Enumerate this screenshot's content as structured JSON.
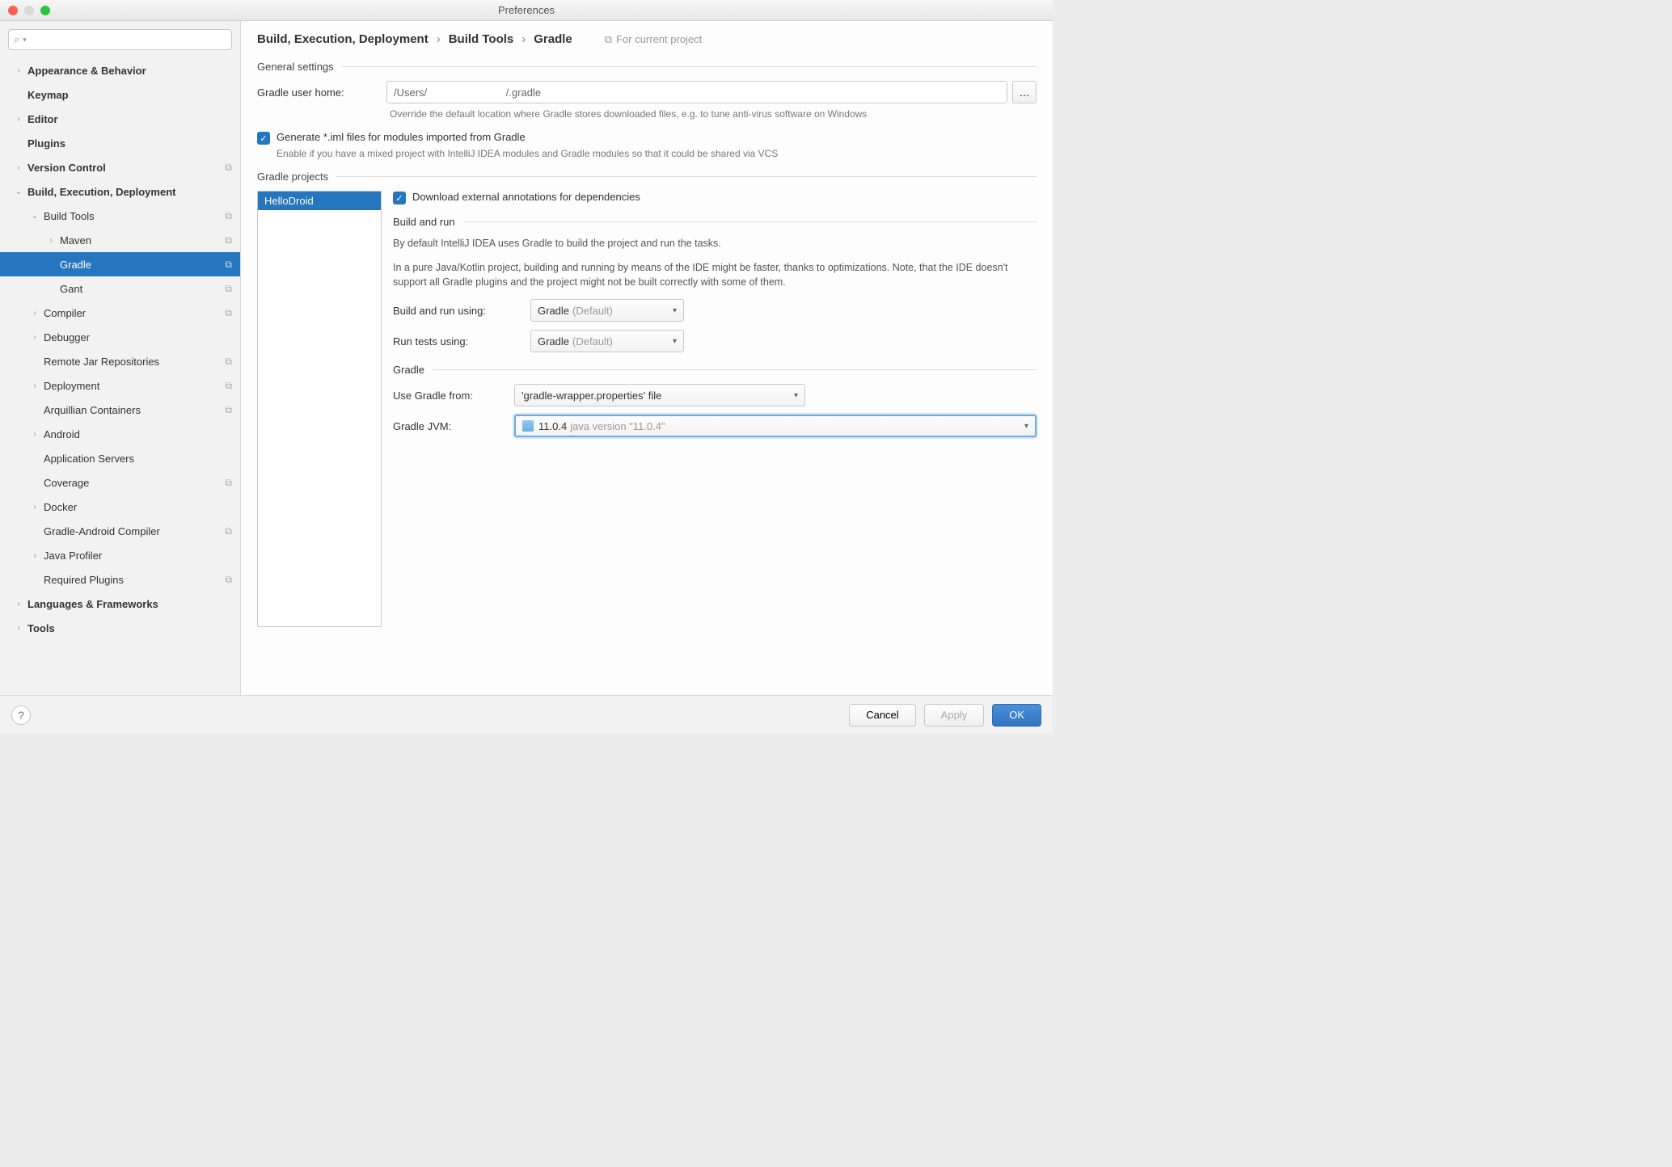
{
  "window": {
    "title": "Preferences"
  },
  "search": {
    "placeholder": ""
  },
  "breadcrumb": {
    "a": "Build, Execution, Deployment",
    "b": "Build Tools",
    "c": "Gradle",
    "hint": "For current project"
  },
  "tree": [
    {
      "label": "Appearance & Behavior",
      "indent": 0,
      "arrow": "›",
      "bold": true
    },
    {
      "label": "Keymap",
      "indent": 0,
      "arrow": "",
      "bold": true
    },
    {
      "label": "Editor",
      "indent": 0,
      "arrow": "›",
      "bold": true
    },
    {
      "label": "Plugins",
      "indent": 0,
      "arrow": "",
      "bold": true
    },
    {
      "label": "Version Control",
      "indent": 0,
      "arrow": "›",
      "bold": true,
      "copy": true
    },
    {
      "label": "Build, Execution, Deployment",
      "indent": 0,
      "arrow": "⌄",
      "bold": true
    },
    {
      "label": "Build Tools",
      "indent": 1,
      "arrow": "⌄",
      "bold": false,
      "copy": true
    },
    {
      "label": "Maven",
      "indent": 2,
      "arrow": "›",
      "bold": false,
      "copy": true
    },
    {
      "label": "Gradle",
      "indent": 2,
      "arrow": "",
      "bold": false,
      "copy": true,
      "selected": true
    },
    {
      "label": "Gant",
      "indent": 2,
      "arrow": "",
      "bold": false,
      "copy": true
    },
    {
      "label": "Compiler",
      "indent": 1,
      "arrow": "›",
      "bold": false,
      "copy": true
    },
    {
      "label": "Debugger",
      "indent": 1,
      "arrow": "›",
      "bold": false
    },
    {
      "label": "Remote Jar Repositories",
      "indent": 1,
      "arrow": "",
      "bold": false,
      "copy": true
    },
    {
      "label": "Deployment",
      "indent": 1,
      "arrow": "›",
      "bold": false,
      "copy": true
    },
    {
      "label": "Arquillian Containers",
      "indent": 1,
      "arrow": "",
      "bold": false,
      "copy": true
    },
    {
      "label": "Android",
      "indent": 1,
      "arrow": "›",
      "bold": false
    },
    {
      "label": "Application Servers",
      "indent": 1,
      "arrow": "",
      "bold": false
    },
    {
      "label": "Coverage",
      "indent": 1,
      "arrow": "",
      "bold": false,
      "copy": true
    },
    {
      "label": "Docker",
      "indent": 1,
      "arrow": "›",
      "bold": false
    },
    {
      "label": "Gradle-Android Compiler",
      "indent": 1,
      "arrow": "",
      "bold": false,
      "copy": true
    },
    {
      "label": "Java Profiler",
      "indent": 1,
      "arrow": "›",
      "bold": false
    },
    {
      "label": "Required Plugins",
      "indent": 1,
      "arrow": "",
      "bold": false,
      "copy": true
    },
    {
      "label": "Languages & Frameworks",
      "indent": 0,
      "arrow": "›",
      "bold": true
    },
    {
      "label": "Tools",
      "indent": 0,
      "arrow": "›",
      "bold": true
    }
  ],
  "general": {
    "title": "General settings",
    "homeLabel": "Gradle user home:",
    "homeValue": "/Users/                           /.gradle",
    "homeHint": "Override the default location where Gradle stores downloaded files, e.g. to tune anti-virus software on Windows",
    "genImlLabel": "Generate *.iml files for modules imported from Gradle",
    "genImlHint": "Enable if you have a mixed project with IntelliJ IDEA modules and Gradle modules so that it could be shared via VCS"
  },
  "projects": {
    "title": "Gradle projects",
    "items": [
      "HelloDroid"
    ],
    "downloadAnnotations": "Download external annotations for dependencies",
    "buildRunTitle": "Build and run",
    "buildRunNote1": "By default IntelliJ IDEA uses Gradle to build the project and run the tasks.",
    "buildRunNote2": "In a pure Java/Kotlin project, building and running by means of the IDE might be faster, thanks to optimizations. Note, that the IDE doesn't support all Gradle plugins and the project might not be built correctly with some of them.",
    "buildUsingLabel": "Build and run using:",
    "buildUsingValue": "Gradle",
    "buildUsingDefault": "(Default)",
    "testsUsingLabel": "Run tests using:",
    "testsUsingValue": "Gradle",
    "testsUsingDefault": "(Default)",
    "gradleTitle": "Gradle",
    "useGradleFromLabel": "Use Gradle from:",
    "useGradleFromValue": "'gradle-wrapper.properties' file",
    "jvmLabel": "Gradle JVM:",
    "jvmVersion": "11.0.4",
    "jvmDetail": "java version \"11.0.4\""
  },
  "footer": {
    "cancel": "Cancel",
    "apply": "Apply",
    "ok": "OK"
  }
}
